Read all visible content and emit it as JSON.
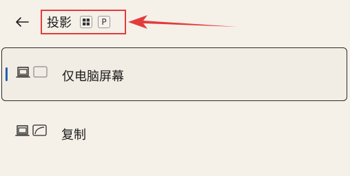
{
  "header": {
    "back_icon": "arrow-left-icon",
    "title": "投影",
    "shortcut_keys": [
      "windows-logo",
      "P"
    ]
  },
  "options": [
    {
      "label": "仅电脑屏幕",
      "icon": "pc-screen-only-icon",
      "selected": true
    },
    {
      "label": "复制",
      "icon": "duplicate-icon",
      "selected": false
    }
  ],
  "colors": {
    "background": "#f5f0e8",
    "annotation_red": "#e23b3b",
    "selection_accent": "#1f5fb5"
  }
}
